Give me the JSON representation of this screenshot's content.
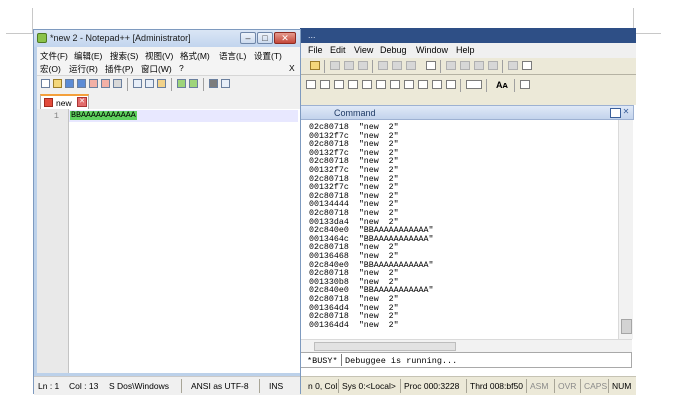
{
  "notepad": {
    "title": "*new  2 - Notepad++ [Administrator]",
    "menu_row1": [
      "文件(F)",
      "编辑(E)",
      "搜索(S)",
      "视图(V)",
      "格式(M)",
      "语言(L)",
      "设置(T)"
    ],
    "menu_row2": [
      "宏(O)",
      "运行(R)",
      "插件(P)",
      "窗口(W)",
      "?"
    ],
    "menu_close": "X",
    "tab_label": "new",
    "line_number": "1",
    "editor_text": "BBAAAAAAAAAAA",
    "status": {
      "ln": "Ln : 1",
      "col": "Col : 13",
      "sel": "S",
      "eol": "Dos\\Windows",
      "encoding": "ANSI as UTF-8",
      "mode": "INS"
    }
  },
  "windbg": {
    "title": "...",
    "menu": [
      "File",
      "Edit",
      "View",
      "Debug",
      "Window",
      "Help"
    ],
    "command_window_title": "Command",
    "output_lines": [
      [
        "02c80718",
        "\"new  2\""
      ],
      [
        "00132f7c",
        "\"new  2\""
      ],
      [
        "02c80718",
        "\"new  2\""
      ],
      [
        "00132f7c",
        "\"new  2\""
      ],
      [
        "02c80718",
        "\"new  2\""
      ],
      [
        "00132f7c",
        "\"new  2\""
      ],
      [
        "02c80718",
        "\"new  2\""
      ],
      [
        "00132f7c",
        "\"new  2\""
      ],
      [
        "02c80718",
        "\"new  2\""
      ],
      [
        "00134444",
        "\"new  2\""
      ],
      [
        "02c80718",
        "\"new  2\""
      ],
      [
        "00133da4",
        "\"new  2\""
      ],
      [
        "02c840e0",
        "\"BBAAAAAAAAAAA\""
      ],
      [
        "0013464c",
        "\"BBAAAAAAAAAAA\""
      ],
      [
        "02c80718",
        "\"new  2\""
      ],
      [
        "00136468",
        "\"new  2\""
      ],
      [
        "02c840e0",
        "\"BBAAAAAAAAAAA\""
      ],
      [
        "02c80718",
        "\"new  2\""
      ],
      [
        "001330b8",
        "\"new  2\""
      ],
      [
        "02c840e0",
        "\"BBAAAAAAAAAAA\""
      ],
      [
        "02c80718",
        "\"new  2\""
      ],
      [
        "001364d4",
        "\"new  2\""
      ],
      [
        "02c80718",
        "\"new  2\""
      ],
      [
        "001364d4",
        "\"new  2\""
      ]
    ],
    "cmd_prompt": "*BUSY*",
    "cmd_text": "Debuggee is running...",
    "toolbar_text": "Aᴀ",
    "status": {
      "pos": "n 0, Col",
      "sys": "Sys 0:<Local>",
      "proc": "Proc 000:3228",
      "thrd": "Thrd 008:bf50",
      "asm": "ASM",
      "ovr": "OVR",
      "caps": "CAPS",
      "num": "NUM"
    }
  }
}
